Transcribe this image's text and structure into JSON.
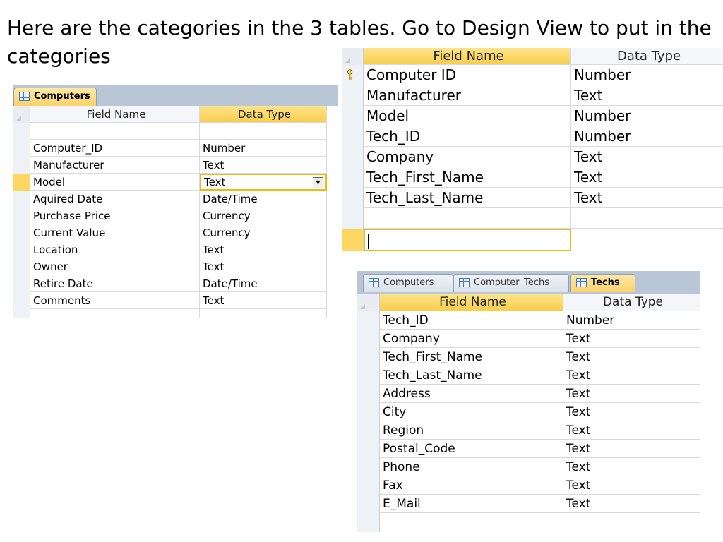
{
  "slide": {
    "title": "Here are the categories in the 3 tables. Go to Design View to put in the categories"
  },
  "computers_table": {
    "tab_label": "Computers",
    "headers": {
      "field_name": "Field Name",
      "data_type": "Data Type"
    },
    "rows": [
      {
        "field": "",
        "type": ""
      },
      {
        "field": "Computer_ID",
        "type": "Number"
      },
      {
        "field": "Manufacturer",
        "type": "Text"
      },
      {
        "field": "Model",
        "type": "Text"
      },
      {
        "field": "Aquired Date",
        "type": "Date/Time"
      },
      {
        "field": "Purchase Price",
        "type": "Currency"
      },
      {
        "field": "Current Value",
        "type": "Currency"
      },
      {
        "field": "Location",
        "type": "Text"
      },
      {
        "field": "Owner",
        "type": "Text"
      },
      {
        "field": "Retire Date",
        "type": "Date/Time"
      },
      {
        "field": "Comments",
        "type": "Text"
      }
    ]
  },
  "computer_techs_table": {
    "headers": {
      "field_name": "Field Name",
      "data_type": "Data Type"
    },
    "rows": [
      {
        "field": "Computer ID",
        "type": "Number"
      },
      {
        "field": "Manufacturer",
        "type": "Text"
      },
      {
        "field": "Model",
        "type": "Number"
      },
      {
        "field": "Tech_ID",
        "type": "Number"
      },
      {
        "field": "Company",
        "type": "Text"
      },
      {
        "field": "Tech_First_Name",
        "type": "Text"
      },
      {
        "field": "Tech_Last_Name",
        "type": "Text"
      }
    ]
  },
  "techs_table": {
    "tabs": [
      "Computers",
      "Computer_Techs",
      "Techs"
    ],
    "headers": {
      "field_name": "Field Name",
      "data_type": "Data Type"
    },
    "rows": [
      {
        "field": "Tech_ID",
        "type": "Number"
      },
      {
        "field": "Company",
        "type": "Text"
      },
      {
        "field": "Tech_First_Name",
        "type": "Text"
      },
      {
        "field": "Tech_Last_Name",
        "type": "Text"
      },
      {
        "field": "Address",
        "type": "Text"
      },
      {
        "field": "City",
        "type": "Text"
      },
      {
        "field": "Region",
        "type": "Text"
      },
      {
        "field": "Postal_Code",
        "type": "Text"
      },
      {
        "field": "Phone",
        "type": "Text"
      },
      {
        "field": "Fax",
        "type": "Text"
      },
      {
        "field": "E_Mail",
        "type": "Text"
      }
    ]
  },
  "colors": {
    "header_active": "#fbd661",
    "tab_bar": "#b9c6d6",
    "focus_border": "#f2b90c"
  }
}
